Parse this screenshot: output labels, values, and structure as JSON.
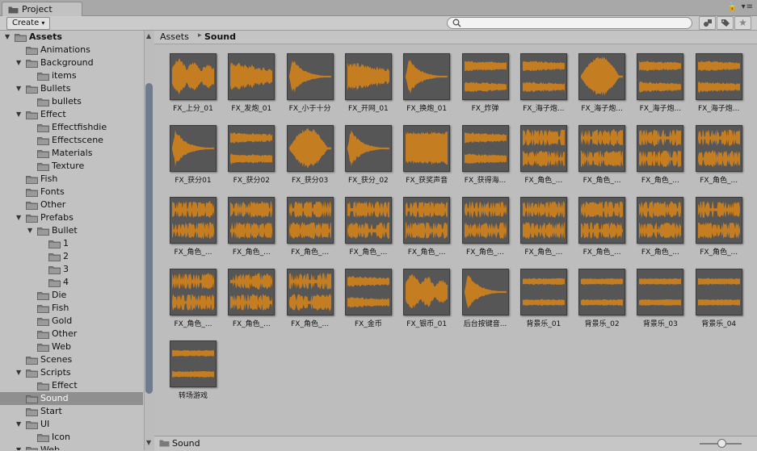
{
  "window": {
    "tab_title": "Project",
    "tab_controls": "🔒 ▾≡"
  },
  "toolbar": {
    "create_label": "Create",
    "create_arrow": "▾",
    "search": {
      "placeholder": "",
      "value": ""
    }
  },
  "icons": {
    "search": "search-icon",
    "filter_type": "filter-by-type-icon",
    "filter_label": "filter-by-label-icon",
    "favorite": "favorite-star-icon",
    "folder": "folder-icon",
    "audio": "audio-clip-icon"
  },
  "colors": {
    "waveform": "#c57d22",
    "thumb_bg": "#565656",
    "selection": "#8f8f8f",
    "panel": "#c2c2c2"
  },
  "tree": [
    {
      "label": "Assets",
      "depth": 0,
      "expanded": true,
      "bold": true
    },
    {
      "label": "Animations",
      "depth": 1
    },
    {
      "label": "Background",
      "depth": 1,
      "expanded": true
    },
    {
      "label": "items",
      "depth": 2
    },
    {
      "label": "Bullets",
      "depth": 1,
      "expanded": true
    },
    {
      "label": "bullets",
      "depth": 2
    },
    {
      "label": "Effect",
      "depth": 1,
      "expanded": true
    },
    {
      "label": "Effectfishdie",
      "depth": 2
    },
    {
      "label": "Effectscene",
      "depth": 2
    },
    {
      "label": "Materials",
      "depth": 2
    },
    {
      "label": "Texture",
      "depth": 2
    },
    {
      "label": "Fish",
      "depth": 1
    },
    {
      "label": "Fonts",
      "depth": 1
    },
    {
      "label": "Other",
      "depth": 1
    },
    {
      "label": "Prefabs",
      "depth": 1,
      "expanded": true
    },
    {
      "label": "Bullet",
      "depth": 2,
      "expanded": true
    },
    {
      "label": "1",
      "depth": 3
    },
    {
      "label": "2",
      "depth": 3
    },
    {
      "label": "3",
      "depth": 3
    },
    {
      "label": "4",
      "depth": 3
    },
    {
      "label": "Die",
      "depth": 2
    },
    {
      "label": "Fish",
      "depth": 2
    },
    {
      "label": "Gold",
      "depth": 2
    },
    {
      "label": "Other",
      "depth": 2
    },
    {
      "label": "Web",
      "depth": 2
    },
    {
      "label": "Scenes",
      "depth": 1
    },
    {
      "label": "Scripts",
      "depth": 1,
      "expanded": true
    },
    {
      "label": "Effect",
      "depth": 2
    },
    {
      "label": "Sound",
      "depth": 1,
      "selected": true
    },
    {
      "label": "Start",
      "depth": 1
    },
    {
      "label": "UI",
      "depth": 1,
      "expanded": true
    },
    {
      "label": "Icon",
      "depth": 2
    },
    {
      "label": "Web",
      "depth": 1,
      "expanded": true
    }
  ],
  "breadcrumb": {
    "root": "Assets",
    "separator": "▸",
    "current": "Sound"
  },
  "assets": [
    {
      "name": "FX_上分_01",
      "wave": "burst"
    },
    {
      "name": "FX_发炮_01",
      "wave": "noise"
    },
    {
      "name": "FX_小于十分",
      "wave": "decay"
    },
    {
      "name": "FX_开网_01",
      "wave": "noise"
    },
    {
      "name": "FX_换炮_01",
      "wave": "decay"
    },
    {
      "name": "FX_炸弹",
      "wave": "stereo"
    },
    {
      "name": "FX_海子炮...",
      "wave": "stereo"
    },
    {
      "name": "FX_海子炮...",
      "wave": "swell"
    },
    {
      "name": "FX_海子炮...",
      "wave": "stereo"
    },
    {
      "name": "FX_海子炮...",
      "wave": "stereo"
    },
    {
      "name": "FX_获分01",
      "wave": "decay"
    },
    {
      "name": "FX_获分02",
      "wave": "stereo"
    },
    {
      "name": "FX_获分03",
      "wave": "swell"
    },
    {
      "name": "FX_获分_02",
      "wave": "decay"
    },
    {
      "name": "FX_获奖声音",
      "wave": "block"
    },
    {
      "name": "FX_获得海...",
      "wave": "stereo"
    },
    {
      "name": "FX_角色_...",
      "wave": "speech"
    },
    {
      "name": "FX_角色_...",
      "wave": "speech"
    },
    {
      "name": "FX_角色_...",
      "wave": "speech"
    },
    {
      "name": "FX_角色_...",
      "wave": "speech"
    },
    {
      "name": "FX_角色_...",
      "wave": "speech"
    },
    {
      "name": "FX_角色_...",
      "wave": "speech"
    },
    {
      "name": "FX_角色_...",
      "wave": "speech"
    },
    {
      "name": "FX_角色_...",
      "wave": "speech"
    },
    {
      "name": "FX_角色_...",
      "wave": "speech"
    },
    {
      "name": "FX_角色_...",
      "wave": "speech"
    },
    {
      "name": "FX_角色_...",
      "wave": "speech"
    },
    {
      "name": "FX_角色_...",
      "wave": "speech"
    },
    {
      "name": "FX_角色_...",
      "wave": "speech"
    },
    {
      "name": "FX_角色_...",
      "wave": "speech"
    },
    {
      "name": "FX_角色_...",
      "wave": "speech"
    },
    {
      "name": "FX_角色_...",
      "wave": "speech"
    },
    {
      "name": "FX_角色_...",
      "wave": "speech"
    },
    {
      "name": "FX_金币",
      "wave": "stereo"
    },
    {
      "name": "FX_银币_01",
      "wave": "burst"
    },
    {
      "name": "后台按键音...",
      "wave": "decay"
    },
    {
      "name": "背景乐_01",
      "wave": "music"
    },
    {
      "name": "背景乐_02",
      "wave": "music"
    },
    {
      "name": "背景乐_03",
      "wave": "music"
    },
    {
      "name": "背景乐_04",
      "wave": "music"
    },
    {
      "name": "转场游戏",
      "wave": "music"
    }
  ],
  "footer": {
    "path_label": "Sound"
  }
}
